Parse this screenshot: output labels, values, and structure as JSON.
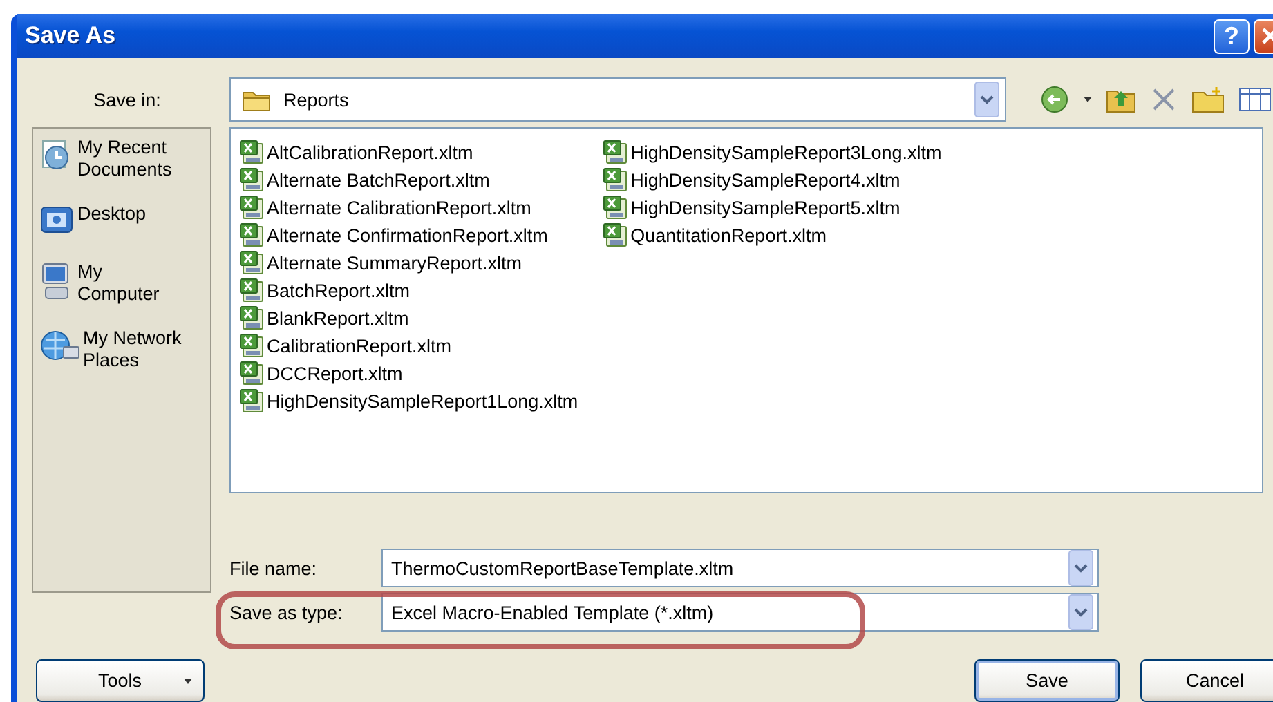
{
  "window": {
    "title": "Save As",
    "help_button": "?"
  },
  "save_in": {
    "label": "Save in:",
    "value": "Reports"
  },
  "places": [
    {
      "label": "My Recent Documents",
      "kind": "recent"
    },
    {
      "label": "Desktop",
      "kind": "desktop"
    },
    {
      "label": "My Computer",
      "kind": "computer"
    },
    {
      "label": "My Network Places",
      "kind": "network"
    }
  ],
  "files": [
    "AltCalibrationReport.xltm",
    "Alternate BatchReport.xltm",
    "Alternate CalibrationReport.xltm",
    "Alternate ConfirmationReport.xltm",
    "Alternate SummaryReport.xltm",
    "BatchReport.xltm",
    "BlankReport.xltm",
    "CalibrationReport.xltm",
    "DCCReport.xltm",
    "HighDensitySampleReport1Long.xltm",
    "HighDensitySampleReport3Long.xltm",
    "HighDensitySampleReport4.xltm",
    "HighDensitySampleReport5.xltm",
    "QuantitationReport.xltm"
  ],
  "file_name": {
    "label": "File name:",
    "value": "ThermoCustomReportBaseTemplate.xltm"
  },
  "save_as_type": {
    "label": "Save as type:",
    "value": "Excel Macro-Enabled Template (*.xltm)",
    "highlighted": true
  },
  "buttons": {
    "tools": "Tools",
    "save": "Save",
    "cancel": "Cancel"
  }
}
